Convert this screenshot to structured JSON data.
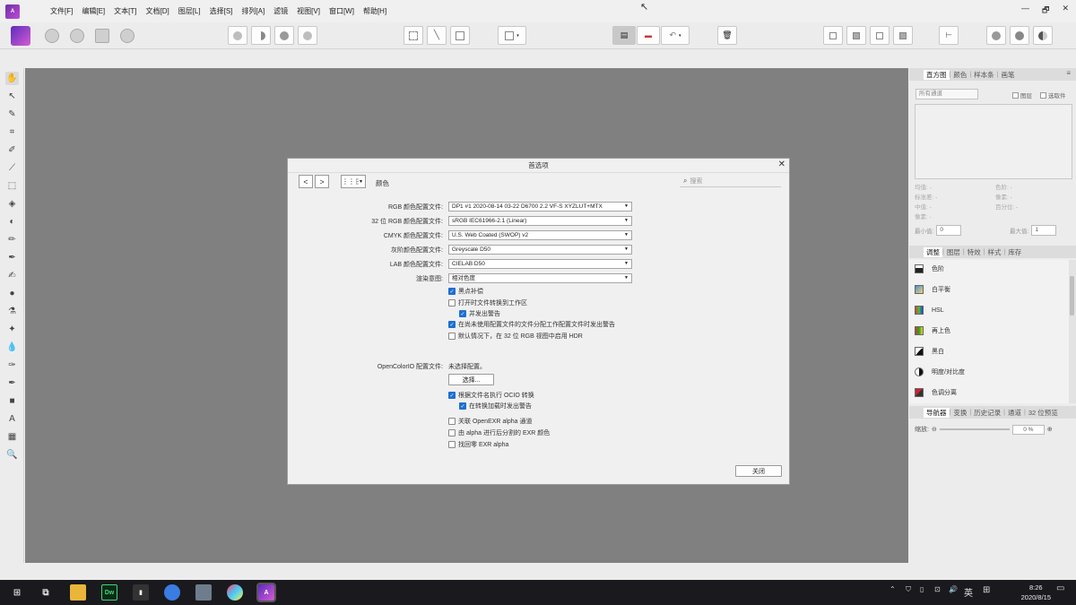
{
  "menubar": {
    "items": [
      "文件[F]",
      "编辑[E]",
      "文本[T]",
      "文档[D]",
      "图层[L]",
      "选择[S]",
      "排列[A]",
      "滤镜",
      "视图[V]",
      "窗口[W]",
      "帮助[H]"
    ],
    "controls": [
      "—",
      "🗗",
      "✕"
    ]
  },
  "dialog": {
    "title": "首选项",
    "section": "颜色",
    "search_placeholder": "搜索",
    "nav_back": "<",
    "nav_forward": ">",
    "rows": [
      {
        "label": "RGB 颜色配置文件:",
        "value": "DP1 #1 2020-08-14 03-22 D6700 2.2 VF-S XYZLUT+MTX"
      },
      {
        "label": "32 位 RGB 颜色配置文件:",
        "value": "sRGB IEC61966-2.1 (Linear)"
      },
      {
        "label": "CMYK 颜色配置文件:",
        "value": "U.S. Web Coated (SWOP) v2"
      },
      {
        "label": "灰阶颜色配置文件:",
        "value": "Greyscale D50"
      },
      {
        "label": "LAB 颜色配置文件:",
        "value": "CIELAB D50"
      },
      {
        "label": "渲染意图:",
        "value": "相对色度"
      }
    ],
    "checks": [
      {
        "label": "黑点补偿",
        "checked": true
      },
      {
        "label": "打开时文件转换到工作区",
        "checked": false
      },
      {
        "label": "并发出警告",
        "checked": true
      },
      {
        "label": "在尚未使用配置文件的文件分配工作配置文件时发出警告",
        "checked": true
      },
      {
        "label": "默认情况下，在 32 位 RGB 视图中启用 HDR",
        "checked": false
      }
    ],
    "ocio_label": "OpenColorIO 配置文件:",
    "ocio_value": "未选择配置。",
    "choose_button": "选择...",
    "checks2": [
      {
        "label": "根据文件名执行 OCIO 转换",
        "checked": true
      },
      {
        "label": "在转换加载时发出警告",
        "checked": true
      },
      {
        "label": "关联 OpenEXR alpha 通道",
        "checked": false
      },
      {
        "label": "由 alpha 进行后分割的 EXR 颜色",
        "checked": false
      },
      {
        "label": "找回零 EXR alpha",
        "checked": false
      }
    ],
    "close_button": "关闭"
  },
  "right_panel": {
    "tabs_top": [
      "直方图",
      "颜色",
      "样本条",
      "画笔"
    ],
    "channel_select": "所有通道",
    "chk_layer": "图层",
    "chk_selection": "选取件",
    "stats_left": [
      "均值: -",
      "标准差: -",
      "中值: -",
      "像素: -"
    ],
    "stats_right": [
      "色阶: -",
      "像素: -",
      "百分位: -"
    ],
    "min_label": "最小值:",
    "min_value": "0",
    "max_label": "最大值:",
    "max_value": "1",
    "tabs_mid": [
      "调整",
      "图层",
      "特效",
      "样式",
      "库存"
    ],
    "adjustments": [
      "色阶",
      "白平衡",
      "HSL",
      "再上色",
      "黑白",
      "明度/对比度",
      "色调分离"
    ],
    "tabs_bottom": [
      "导航器",
      "变换",
      "历史记录",
      "通道",
      "32 位预览"
    ],
    "zoom_label": "缩放:",
    "zoom_value": "0 %"
  },
  "taskbar": {
    "ime": "英",
    "time": "8:26",
    "date": "2020/8/15"
  },
  "colors": {
    "canvas": "#808080",
    "accent": "#1f6fd0",
    "brand": "#7b36c2"
  }
}
